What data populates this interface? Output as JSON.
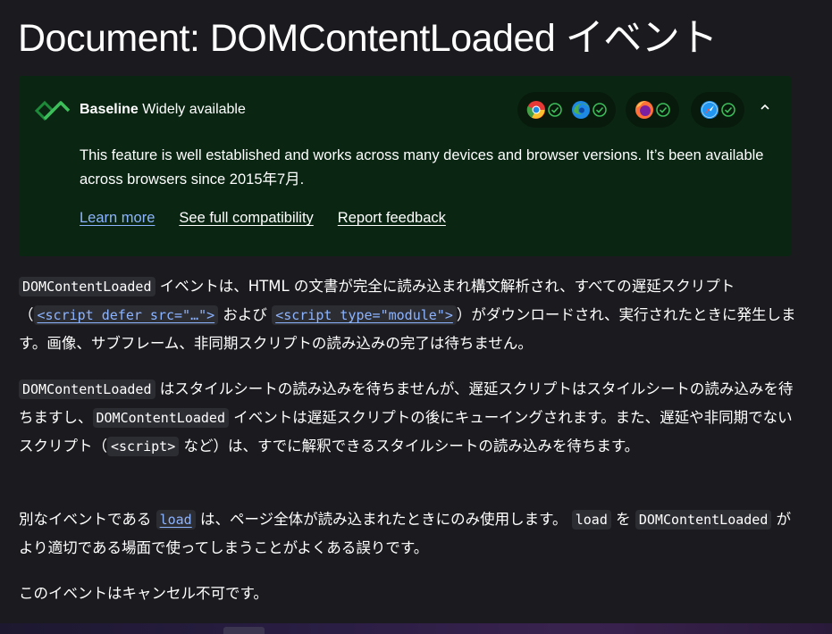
{
  "page": {
    "title": "Document: DOMContentLoaded イベント"
  },
  "baseline": {
    "label_bold": "Baseline",
    "label_rest": "Widely available",
    "description": "This feature is well established and works across many devices and browser versions. It’s been available across browsers since 2015年7月.",
    "links": {
      "learn_more": "Learn more",
      "compat": "See full compatibility",
      "feedback": "Report feedback"
    },
    "browsers": [
      {
        "name": "chrome-icon",
        "supported": true
      },
      {
        "name": "edge-icon",
        "supported": true
      },
      {
        "name": "firefox-icon",
        "supported": true
      },
      {
        "name": "safari-icon",
        "supported": true
      }
    ],
    "colors": {
      "background": "#0a2612",
      "check": "#3dbf5b",
      "link": "#8cb4ff"
    }
  },
  "paragraphs": {
    "p1": {
      "code1": "DOMContentLoaded",
      "t1": " イベントは、HTML の文書が完全に読み込まれ構文解析され、すべての遅延スクリプト（",
      "code2": "<script defer src=\"…\">",
      "t2": " および ",
      "code3": "<script type=\"module\">",
      "t3": "）がダウンロードされ、実行されたときに発生します。画像、サブフレーム、非同期スクリプトの読み込みの完了は待ちません。"
    },
    "p2": {
      "code1": "DOMContentLoaded",
      "t1": " はスタイルシートの読み込みを待ちませんが、遅延スクリプトはスタイルシートの読み込みを待ちますし、",
      "code2": "DOMContentLoaded",
      "t2": " イベントは遅延スクリプトの後にキューイングされます。また、遅延や非同期でないスクリプト（",
      "code3": "<script>",
      "t3": " など）は、すでに解釈できるスタイルシートの読み込みを待ちます。"
    },
    "p3": {
      "t1": "別なイベントである ",
      "code1": "load",
      "t2": " は、ページ全体が読み込まれたときにのみ使用します。 ",
      "code2": "load",
      "t3": " を ",
      "code3": "DOMContentLoaded",
      "t4": " がより適切である場面で使ってしまうことがよくある誤りです。"
    },
    "p4": {
      "t1": "このイベントはキャンセル不可です。"
    }
  }
}
